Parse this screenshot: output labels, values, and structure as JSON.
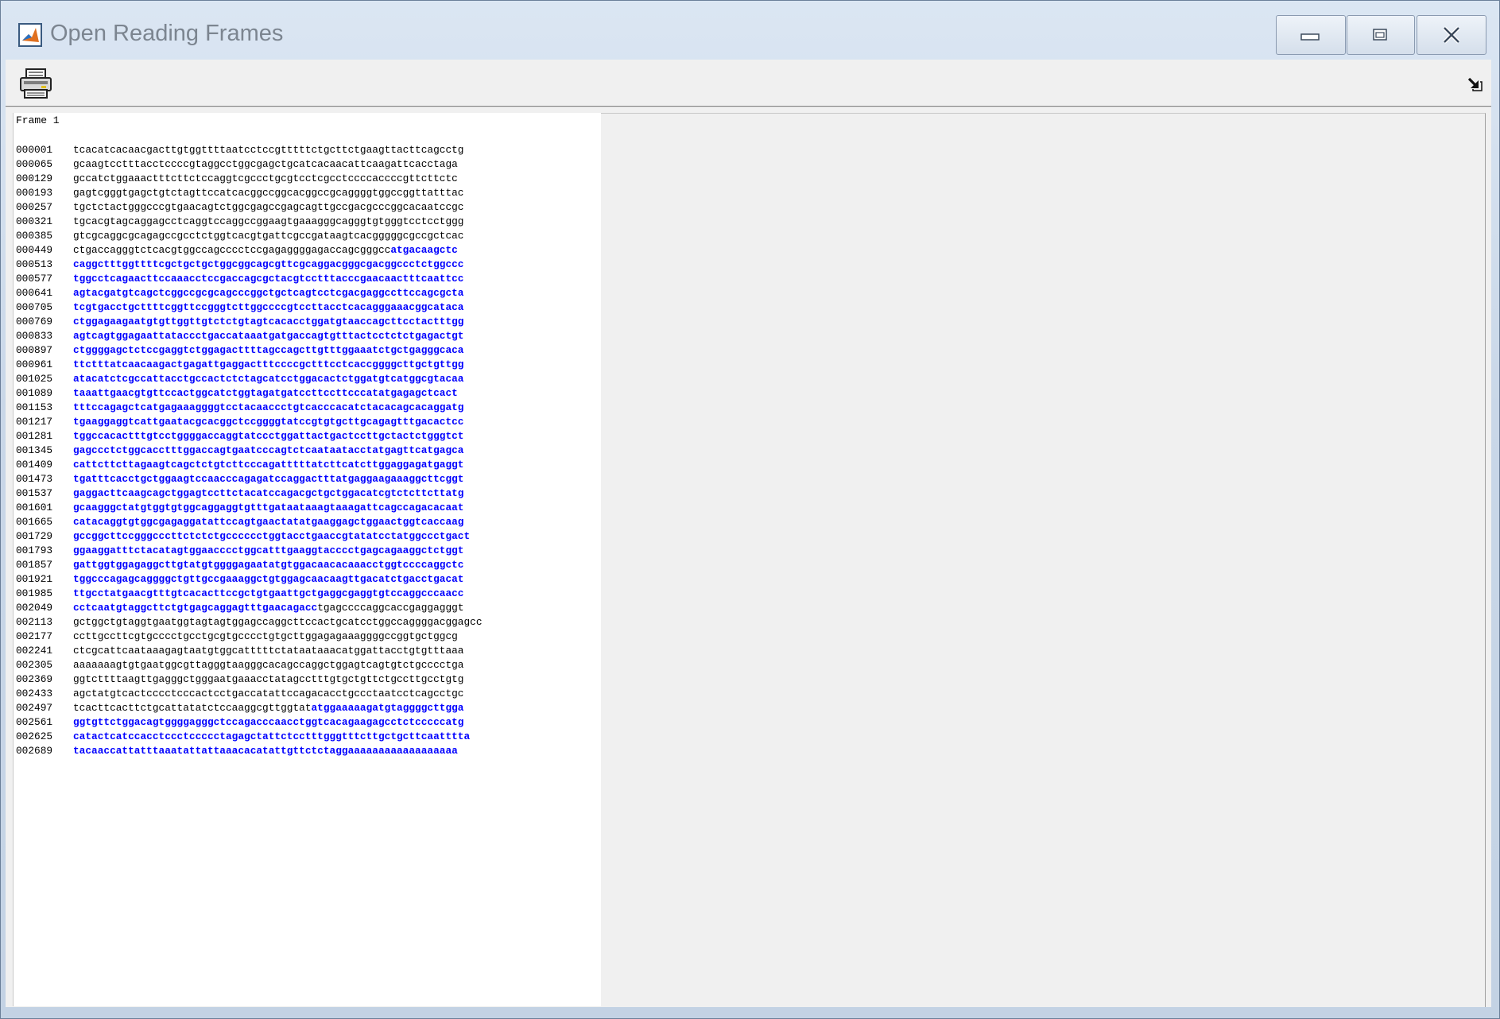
{
  "window": {
    "title": "Open Reading Frames",
    "icon": "matlab-icon",
    "buttons": {
      "minimize": "minimize-icon",
      "maximize": "maximize-icon",
      "close": "close-icon"
    }
  },
  "toolbar": {
    "print_icon": "printer-icon",
    "undock_icon": "undock-arrow-icon"
  },
  "colors": {
    "orf": "#0000ff",
    "normal": "#000000"
  },
  "frame_title": "Frame 1",
  "lines": [
    {
      "pos": "000001",
      "normal": "tcacatcacaacgacttgtggttttaatcctccgtttttctgcttctgaagttacttcagcctg",
      "orf": ""
    },
    {
      "pos": "000065",
      "normal": "gcaagtcctttacctccccgtaggcctggcgagctgcatcacaacattcaagattcacctaga",
      "orf": ""
    },
    {
      "pos": "000129",
      "normal": "gccatctggaaactttcttctccaggtcgccctgcgtcctcgcctccccaccccgttcttctc",
      "orf": ""
    },
    {
      "pos": "000193",
      "normal": "gagtcgggtgagctgtctagttccatcacggccggcacggccgcaggggtggccggttatttac",
      "orf": ""
    },
    {
      "pos": "000257",
      "normal": "tgctctactgggcccgtgaacagtctggcgagccgagcagttgccgacgcccggcacaatccgc",
      "orf": ""
    },
    {
      "pos": "000321",
      "normal": "tgcacgtagcaggagcctcaggtccaggccggaagtgaaagggcagggtgtgggtcctcctggg",
      "orf": ""
    },
    {
      "pos": "000385",
      "normal": "gtcgcaggcgcagagccgcctctggtcacgtgattcgccgataagtcacgggggcgccgctcac",
      "orf": ""
    },
    {
      "pos": "000449",
      "normal": "ctgaccagggtctcacgtggccagcccctccgagaggggagaccagcgggcc",
      "orf": "atgacaagctc"
    },
    {
      "pos": "000513",
      "normal": "",
      "orf": "caggctttggttttcgctgctgctggcggcagcgttcgcaggacgggcgacggccctctggccc"
    },
    {
      "pos": "000577",
      "normal": "",
      "orf": "tggcctcagaacttccaaacctccgaccagcgctacgtcctttacccgaacaactttcaattcc"
    },
    {
      "pos": "000641",
      "normal": "",
      "orf": "agtacgatgtcagctcggccgcgcagcccggctgctcagtcctcgacgaggccttccagcgcta"
    },
    {
      "pos": "000705",
      "normal": "",
      "orf": "tcgtgacctgcttttcggttccgggtcttggccccgtccttacctcacagggaaacggcataca"
    },
    {
      "pos": "000769",
      "normal": "",
      "orf": "ctggagaagaatgtgttggttgtctctgtagtcacacctggatgtaaccagcttcctactttgg"
    },
    {
      "pos": "000833",
      "normal": "",
      "orf": "agtcagtggagaattataccctgaccataaatgatgaccagtgtttactcctctctgagactgt"
    },
    {
      "pos": "000897",
      "normal": "",
      "orf": "ctggggagctctccgaggtctggagacttttagccagcttgtttggaaatctgctgagggcaca"
    },
    {
      "pos": "000961",
      "normal": "",
      "orf": "ttctttatcaacaagactgagattgaggactttccccgctttcctcaccggggcttgctgttgg"
    },
    {
      "pos": "001025",
      "normal": "",
      "orf": "atacatctcgccattacctgccactctctagcatcctggacactctggatgtcatggcgtacaa"
    },
    {
      "pos": "001089",
      "normal": "",
      "orf": "taaattgaacgtgttccactggcatctggtagatgatccttccttcccatatgagagctcact"
    },
    {
      "pos": "001153",
      "normal": "",
      "orf": "tttccagagctcatgagaaaggggtcctacaaccctgtcacccacatctacacagcacaggatg"
    },
    {
      "pos": "001217",
      "normal": "",
      "orf": "tgaaggaggtcattgaatacgcacggctccggggtatccgtgtgcttgcagagtttgacactcc"
    },
    {
      "pos": "001281",
      "normal": "",
      "orf": "tggccacactttgtcctggggaccaggtatccctggattactgactccttgctactctgggtct"
    },
    {
      "pos": "001345",
      "normal": "",
      "orf": "gagccctctggcacctttggaccagtgaatcccagtctcaataatacctatgagttcatgagca"
    },
    {
      "pos": "001409",
      "normal": "",
      "orf": "cattcttcttagaagtcagctctgtcttcccagatttttatcttcatcttggaggagatgaggt"
    },
    {
      "pos": "001473",
      "normal": "",
      "orf": "tgatttcacctgctggaagtccaacccagagatccaggactttatgaggaagaaaggcttcggt"
    },
    {
      "pos": "001537",
      "normal": "",
      "orf": "gaggacttcaagcagctggagtccttctacatccagacgctgctggacatcgtctcttcttatg"
    },
    {
      "pos": "001601",
      "normal": "",
      "orf": "gcaagggctatgtggtgtggcaggaggtgtttgataataaagtaaagattcagccagacacaat"
    },
    {
      "pos": "001665",
      "normal": "",
      "orf": "catacaggtgtggcgagaggatattccagtgaactatatgaaggagctggaactggtcaccaag"
    },
    {
      "pos": "001729",
      "normal": "",
      "orf": "gccggcttccgggcccttctctctgcccccctggtacctgaaccgtatatcctatggccctgact"
    },
    {
      "pos": "001793",
      "normal": "",
      "orf": "ggaaggatttctacatagtggaacccctggcatttgaaggtacccctgagcagaaggctctggt"
    },
    {
      "pos": "001857",
      "normal": "",
      "orf": "gattggtggagaggcttgtatgtggggagaatatgtggacaacacaaacctggtccccaggctc"
    },
    {
      "pos": "001921",
      "normal": "",
      "orf": "tggcccagagcaggggctgttgccgaaaggctgtggagcaacaagttgacatctgacctgacat"
    },
    {
      "pos": "001985",
      "normal": "",
      "orf": "ttgcctatgaacgtttgtcacacttccgctgtgaattgctgaggcgaggtgtccaggcccaacc"
    },
    {
      "pos": "002049",
      "normal": "tgagccccaggcaccgaggagggt",
      "orf": "cctcaatgtaggcttctgtgagcaggagtttgaacagacc",
      "orf_first": true
    },
    {
      "pos": "002113",
      "normal": "gctggctgtaggtgaatggtagtagtggagccaggcttccactgcatcctggccaggggacggagcc",
      "orf": ""
    },
    {
      "pos": "002177",
      "normal": "ccttgccttcgtgcccctgcctgcgtgcccctgtgcttggagagaaaggggccggtgctggcg",
      "orf": ""
    },
    {
      "pos": "002241",
      "normal": "ctcgcattcaataaagagtaatgtggcatttttctataataaacatggattacctgtgtttaaa",
      "orf": ""
    },
    {
      "pos": "002305",
      "normal": "aaaaaaagtgtgaatggcgttagggtaagggcacagccaggctggagtcagtgtctgcccctga",
      "orf": ""
    },
    {
      "pos": "002369",
      "normal": "ggtcttttaagttgagggctgggaatgaaacctatagcctttgtgctgttctgccttgcctgtg",
      "orf": ""
    },
    {
      "pos": "002433",
      "normal": "agctatgtcactcccctcccactcctgaccatattccagacacctgccctaatcctcagcctgc",
      "orf": ""
    },
    {
      "pos": "002497",
      "normal": "tcacttcacttctgcattatatctccaaggcgttggtat",
      "orf": "atggaaaaagatgtaggggcttgga"
    },
    {
      "pos": "002561",
      "normal": "",
      "orf": "ggtgttctggacagtggggagggctccagacccaacctggtcacagaagagcctctcccccatg"
    },
    {
      "pos": "002625",
      "normal": "",
      "orf": "catactcatccacctccctccccctagagctattctcctttgggtttcttgctgcttcaatttta"
    },
    {
      "pos": "002689",
      "normal": "",
      "orf": "tacaaccattatttaaatattattaaacacatattgttctctaggaaaaaaaaaaaaaaaaaa"
    }
  ]
}
